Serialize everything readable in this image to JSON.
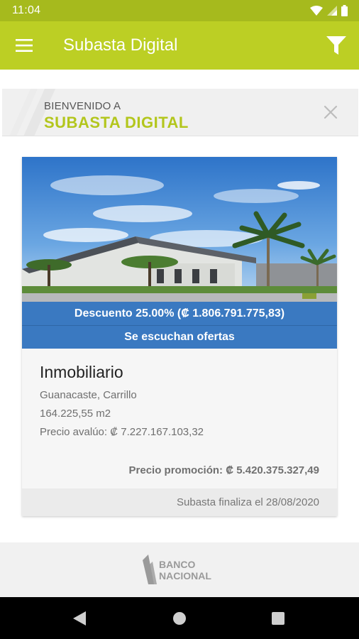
{
  "status_bar": {
    "time": "11:04",
    "icons": [
      "wifi-icon",
      "signal-icon",
      "battery-icon"
    ]
  },
  "app_bar": {
    "title": "Subasta Digital",
    "menu_icon": "hamburger-menu-icon",
    "filter_icon": "filter-icon"
  },
  "welcome_banner": {
    "line1": "BIENVENIDO A",
    "line2": "SUBASTA DIGITAL",
    "close_icon": "close-icon"
  },
  "listing": {
    "discount": "Descuento 25.00% (₡ 1.806.791.775,83)",
    "offers_status": "Se escuchan ofertas",
    "category": "Inmobiliario",
    "location": "Guanacaste, Carrillo",
    "area": "164.225,55 m2",
    "appraisal": "Precio avalúo: ₡ 7.227.167.103,32",
    "promo_price": "Precio promoción: ₡ 5.420.375.327,49",
    "end_date": "Subasta finaliza el 28/08/2020"
  },
  "footer": {
    "logo_text": [
      "BANCO",
      "NACIONAL"
    ]
  },
  "nav_bar": {
    "buttons": [
      "back-icon",
      "home-icon",
      "recents-icon"
    ]
  },
  "colors": {
    "status_bar": "#a6ba1d",
    "app_bar": "#bccf24",
    "accent_green": "#b3c61d",
    "strip_blue": "#3a79c1"
  }
}
